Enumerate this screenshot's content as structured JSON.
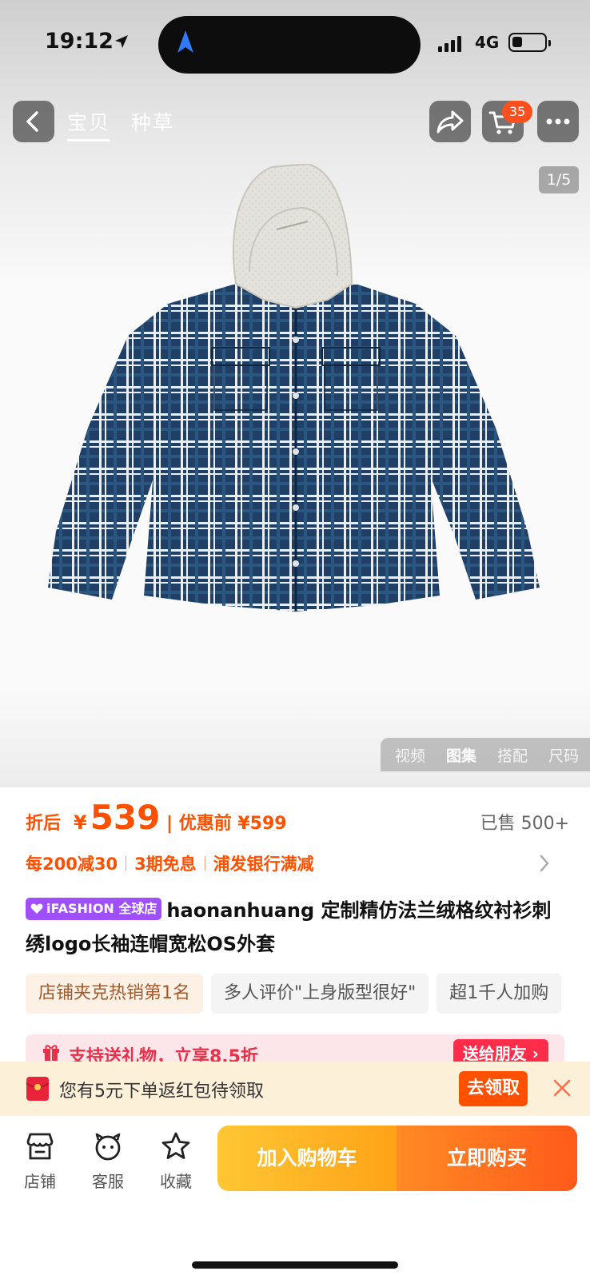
{
  "status_bar": {
    "time": "19:12",
    "network": "4G"
  },
  "top_nav": {
    "tabs": [
      "宝贝",
      "种草"
    ],
    "cart_badge": "35"
  },
  "gallery": {
    "counter": "1/5",
    "media_tabs": [
      "视频",
      "图集",
      "搭配",
      "尺码"
    ],
    "active_media_tab": "图集"
  },
  "price": {
    "after_label": "折后",
    "currency": "¥",
    "after_value": "539",
    "before_text": "| 优惠前 ¥599",
    "sold": "已售 500+"
  },
  "promos": [
    "每200减30",
    "3期免息",
    "浦发银行满减"
  ],
  "product": {
    "badge": "iFASHION 全球店",
    "title": "haonanhuang 定制精仿法兰绒格纹衬衫刺绣logo长袖连帽宽松OS外套"
  },
  "tags": [
    "店铺夹克热销第1名",
    "多人评价\"上身版型很好\"",
    "超1千人加购"
  ],
  "gift": {
    "text": "支持送礼物，立享8.5折",
    "button": "送给朋友 ›"
  },
  "coupon": {
    "text": "您有5元下单返红包待领取",
    "button": "去领取"
  },
  "bottom": {
    "shop": "店铺",
    "service": "客服",
    "favorite": "收藏",
    "add_to_cart": "加入购物车",
    "buy_now": "立即购买"
  },
  "colors": {
    "accent": "#ff5000",
    "badge_purple": "#a04fff",
    "gift_red": "#ff2d4a",
    "cta_yellow": "#ffa318"
  }
}
